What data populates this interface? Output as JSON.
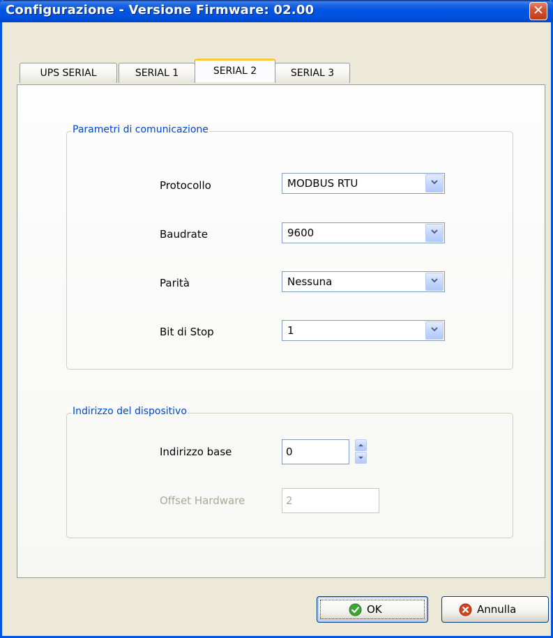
{
  "window": {
    "title": "Configurazione - Versione Firmware: 02.00",
    "close_label": "✕"
  },
  "tabs": [
    {
      "label": "UPS SERIAL",
      "active": false
    },
    {
      "label": "SERIAL 1",
      "active": false
    },
    {
      "label": "SERIAL 2",
      "active": true
    },
    {
      "label": "SERIAL 3",
      "active": false
    }
  ],
  "communication": {
    "legend": "Parametri di comunicazione",
    "protocol": {
      "label": "Protocollo",
      "value": "MODBUS RTU"
    },
    "baudrate": {
      "label": "Baudrate",
      "value": "9600"
    },
    "parity": {
      "label": "Parità",
      "value": "Nessuna"
    },
    "stop_bits": {
      "label": "Bit di Stop",
      "value": "1"
    }
  },
  "device_address": {
    "legend": "Indirizzo del dispositivo",
    "base_address": {
      "label": "Indirizzo base",
      "value": "0"
    },
    "hardware_offset": {
      "label": "Offset Hardware",
      "value": "2"
    }
  },
  "buttons": {
    "ok": "OK",
    "cancel": "Annulla"
  },
  "colors": {
    "titlebar": "#0055E5",
    "legend_text": "#0046D5",
    "ok_icon": "#3BA534",
    "cancel_icon": "#D8401E"
  },
  "icons": {
    "close": "close-icon",
    "ok": "checkmark-icon",
    "cancel": "cancel-icon"
  }
}
